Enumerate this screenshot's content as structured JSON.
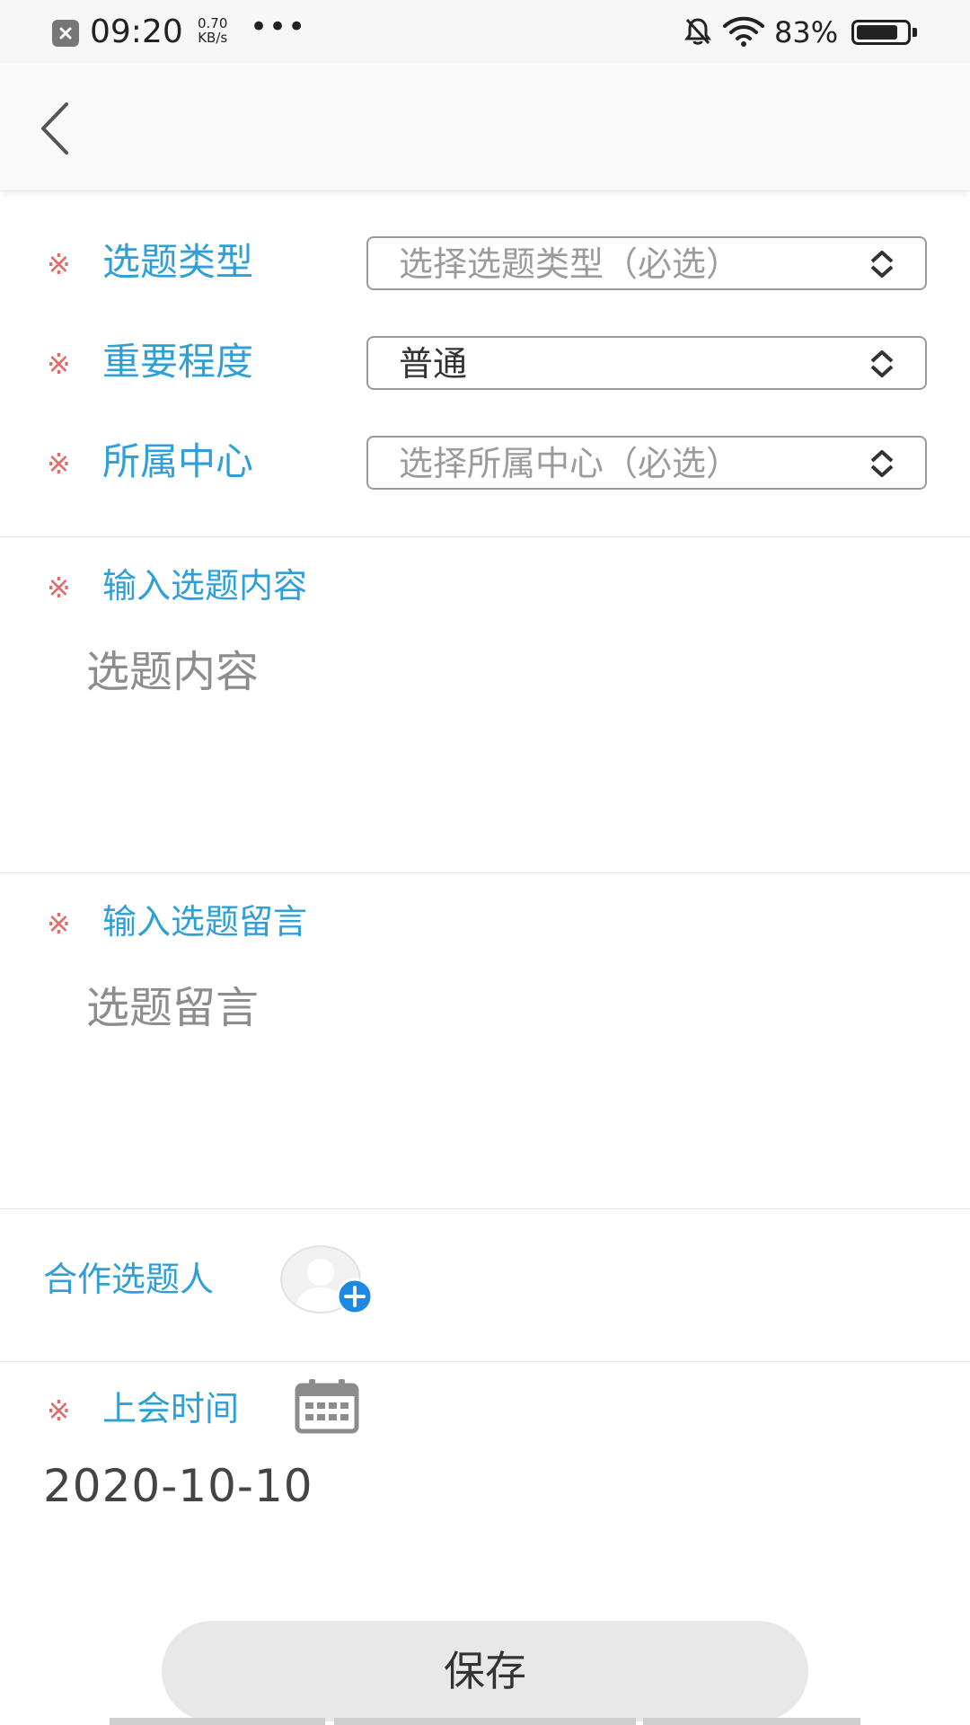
{
  "status_bar": {
    "time": "09:20",
    "speed_value": "0.70",
    "speed_unit": "KB/s",
    "more": "•••",
    "battery_percent": "83%",
    "battery_level": 0.83,
    "icons": [
      "notification-icon",
      "mute-icon",
      "wifi-icon",
      "battery-icon"
    ]
  },
  "nav": {
    "back_icon": "chevron-left-icon"
  },
  "form": {
    "required_mark": "※",
    "topic_type": {
      "label": "选题类型",
      "placeholder": "选择选题类型（必选）"
    },
    "importance": {
      "label": "重要程度",
      "value": "普通"
    },
    "center": {
      "label": "所属中心",
      "placeholder": "选择所属中心（必选）"
    },
    "content": {
      "label": "输入选题内容",
      "placeholder": "选题内容"
    },
    "message": {
      "label": "输入选题留言",
      "placeholder": "选题留言"
    },
    "collaborator": {
      "label": "合作选题人",
      "icons": [
        "avatar-placeholder-icon",
        "add-circle-icon"
      ]
    },
    "meeting_time": {
      "label": "上会时间",
      "value": "2020-10-10",
      "icon": "calendar-icon"
    },
    "save_label": "保存"
  },
  "colors": {
    "label_blue": "#2f9fd6",
    "required_red": "#e06b6b",
    "add_blue": "#1e88e5",
    "save_bg": "#e8e8e8"
  }
}
